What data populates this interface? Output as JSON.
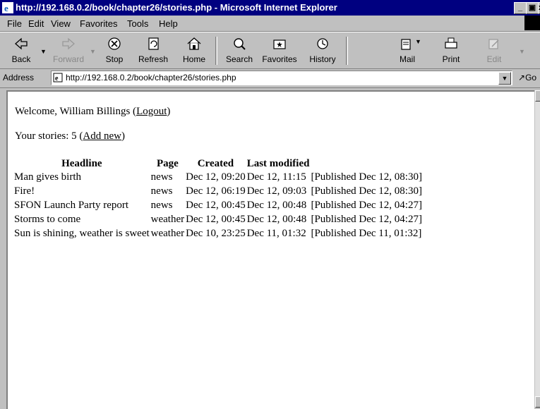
{
  "window": {
    "title": "http://192.168.0.2/book/chapter26/stories.php - Microsoft Internet Explorer"
  },
  "menu": [
    "File",
    "Edit",
    "View",
    "Favorites",
    "Tools",
    "Help"
  ],
  "toolbar": {
    "back": "Back",
    "forward": "Forward",
    "stop": "Stop",
    "refresh": "Refresh",
    "home": "Home",
    "search": "Search",
    "favorites": "Favorites",
    "history": "History",
    "mail": "Mail",
    "print": "Print",
    "edit": "Edit"
  },
  "address": {
    "label": "Address",
    "url": "http://192.168.0.2/book/chapter26/stories.php",
    "go": "Go"
  },
  "page": {
    "welcome_text": "Welcome, William Billings (",
    "logout": "Logout",
    "welcome_close": ")",
    "stories_text": "Your stories: 5 (",
    "add_new": "Add new",
    "stories_close": ")",
    "headers": [
      "Headline",
      "Page",
      "Created",
      "Last modified"
    ],
    "rows": [
      {
        "headline": "Man gives birth",
        "page": "news",
        "created": "Dec 12, 09:20",
        "modified": "Dec 12, 11:15",
        "status": "[Published Dec 12, 08:30]"
      },
      {
        "headline": "Fire!",
        "page": "news",
        "created": "Dec 12, 06:19",
        "modified": "Dec 12, 09:03",
        "status": "[Published Dec 12, 08:30]"
      },
      {
        "headline": "SFON Launch Party report",
        "page": "news",
        "created": "Dec 12, 00:45",
        "modified": "Dec 12, 00:48",
        "status": "[Published Dec 12, 04:27]"
      },
      {
        "headline": "Storms to come",
        "page": "weather",
        "created": "Dec 12, 00:45",
        "modified": "Dec 12, 00:48",
        "status": "[Published Dec 12, 04:27]"
      },
      {
        "headline": "Sun is shining, weather is sweet",
        "page": "weather",
        "created": "Dec 10, 23:25",
        "modified": "Dec 11, 01:32",
        "status": "[Published Dec 11, 01:32]"
      }
    ]
  }
}
